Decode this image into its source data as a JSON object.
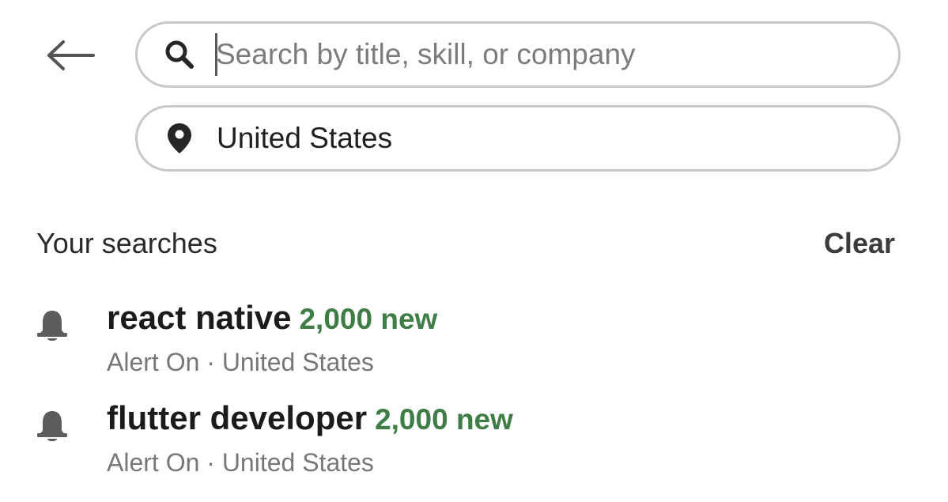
{
  "header": {
    "back_icon": "arrow-left-icon"
  },
  "search": {
    "icon": "search-icon",
    "placeholder": "Search by title, skill, or company",
    "value": ""
  },
  "location": {
    "icon": "location-pin-icon",
    "value": "United States"
  },
  "your_searches": {
    "title": "Your searches",
    "clear_label": "Clear",
    "items": [
      {
        "icon": "bell-icon",
        "query": "react native",
        "new_count": "2,000 new",
        "alert_status": "Alert On",
        "separator": "·",
        "location": "United States"
      },
      {
        "icon": "bell-icon",
        "query": "flutter developer",
        "new_count": "2,000 new",
        "alert_status": "Alert On",
        "separator": "·",
        "location": "United States"
      }
    ]
  },
  "colors": {
    "accent_green": "#3f7d46",
    "border": "#c8c8c8",
    "muted_text": "#777777"
  }
}
